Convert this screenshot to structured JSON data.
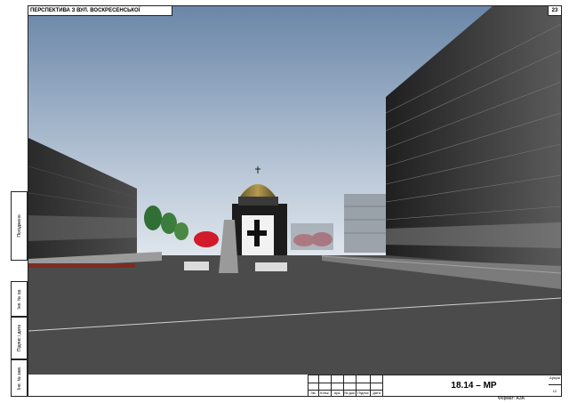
{
  "sheet": {
    "title": "ПЕРСПЕКТИВА З ВУЛ. ВОСКРЕСЕНСЬКОЇ",
    "number": "23",
    "doc_code": "18.14 – МР",
    "format": "Формат: А3А",
    "sheet_label": "Аркуш",
    "sheet_value": "12"
  },
  "side_labels": {
    "agreed": "Погоджено",
    "inv_no": "Інв. № ор.",
    "sign_date": "Підпис і дата",
    "replace_inv": "Інв. № зам."
  },
  "stamp_headers": [
    "Зм.",
    "Кільк.",
    "Арк.",
    "№ док.",
    "Підпис",
    "Дата"
  ],
  "colors": {
    "sky_top": "#6a86a8",
    "sky_bottom": "#dfe7ef",
    "road": "#4a4a4a",
    "building": "#2c2c2c",
    "trees_red": "#d21a2a"
  }
}
